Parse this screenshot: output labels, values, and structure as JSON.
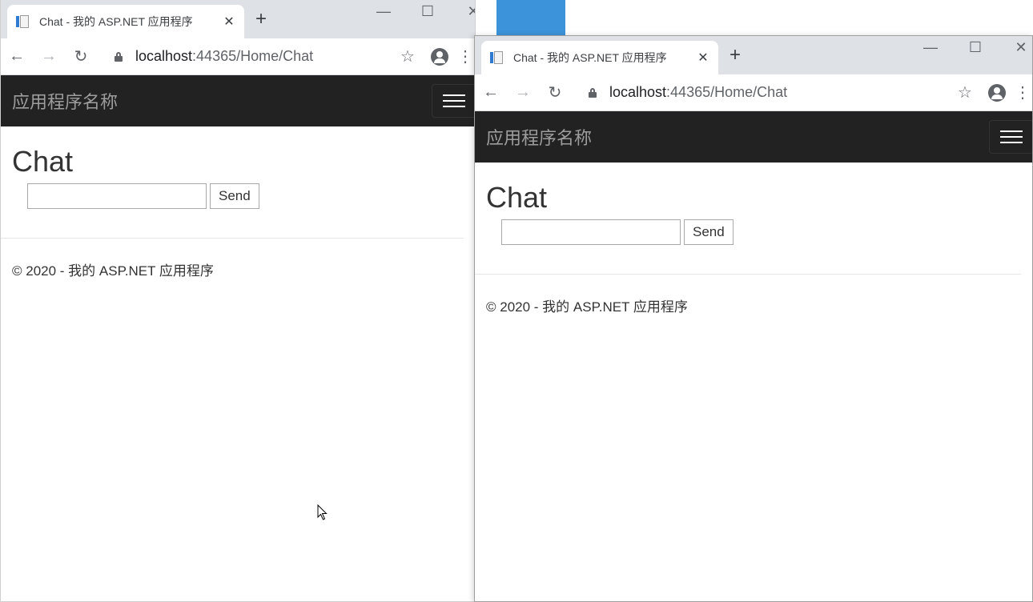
{
  "browser": {
    "tab_title": "Chat - 我的 ASP.NET 应用程序",
    "tab_close": "✕",
    "new_tab": "+",
    "url_host": "localhost",
    "url_rest": ":44365/Home/Chat",
    "back": "←",
    "forward": "→",
    "reload": "↻",
    "star": "☆",
    "menu": "⋮",
    "minimize": "—",
    "maximize": "☐",
    "close": "✕"
  },
  "app": {
    "brand": "应用程序名称",
    "heading": "Chat",
    "input_value": "",
    "send_label": "Send",
    "footer": "© 2020 - 我的 ASP.NET 应用程序"
  },
  "colors": {
    "navbar": "#222222",
    "desktop_blue": "#3c93d9"
  },
  "icons": [
    "favicon-icon",
    "back-arrow-icon",
    "forward-arrow-icon",
    "reload-icon",
    "lock-icon",
    "star-icon",
    "profile-icon",
    "menu-dots-icon",
    "hamburger-icon",
    "mouse-cursor-icon"
  ]
}
